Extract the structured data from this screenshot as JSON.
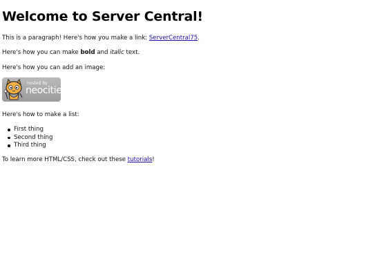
{
  "heading": "Welcome to Server Central!",
  "paragraph_link": {
    "before": "This is a paragraph! Here's how you make a link: ",
    "link_text": "ServerCentral75",
    "after": "."
  },
  "paragraph_bold": {
    "before": "Here's how you can make ",
    "bold": "bold",
    "middle": " and ",
    "italic": "italic",
    "after": " text."
  },
  "paragraph_image": "Here's how you can add an image:",
  "badge": {
    "small_text": "hosted by",
    "big_text": "neocities",
    "icon": "neocities-cat-logo"
  },
  "paragraph_list": "Here's how to make a list:",
  "list_items": [
    "First thing",
    "Second thing",
    "Third thing"
  ],
  "paragraph_learn": {
    "before": "To learn more HTML/CSS, check out these ",
    "link_text": "tutorials",
    "after": "!"
  },
  "colors": {
    "link": "#1a0dab",
    "badge_bg": "#a9a9a9",
    "text": "#111111"
  }
}
